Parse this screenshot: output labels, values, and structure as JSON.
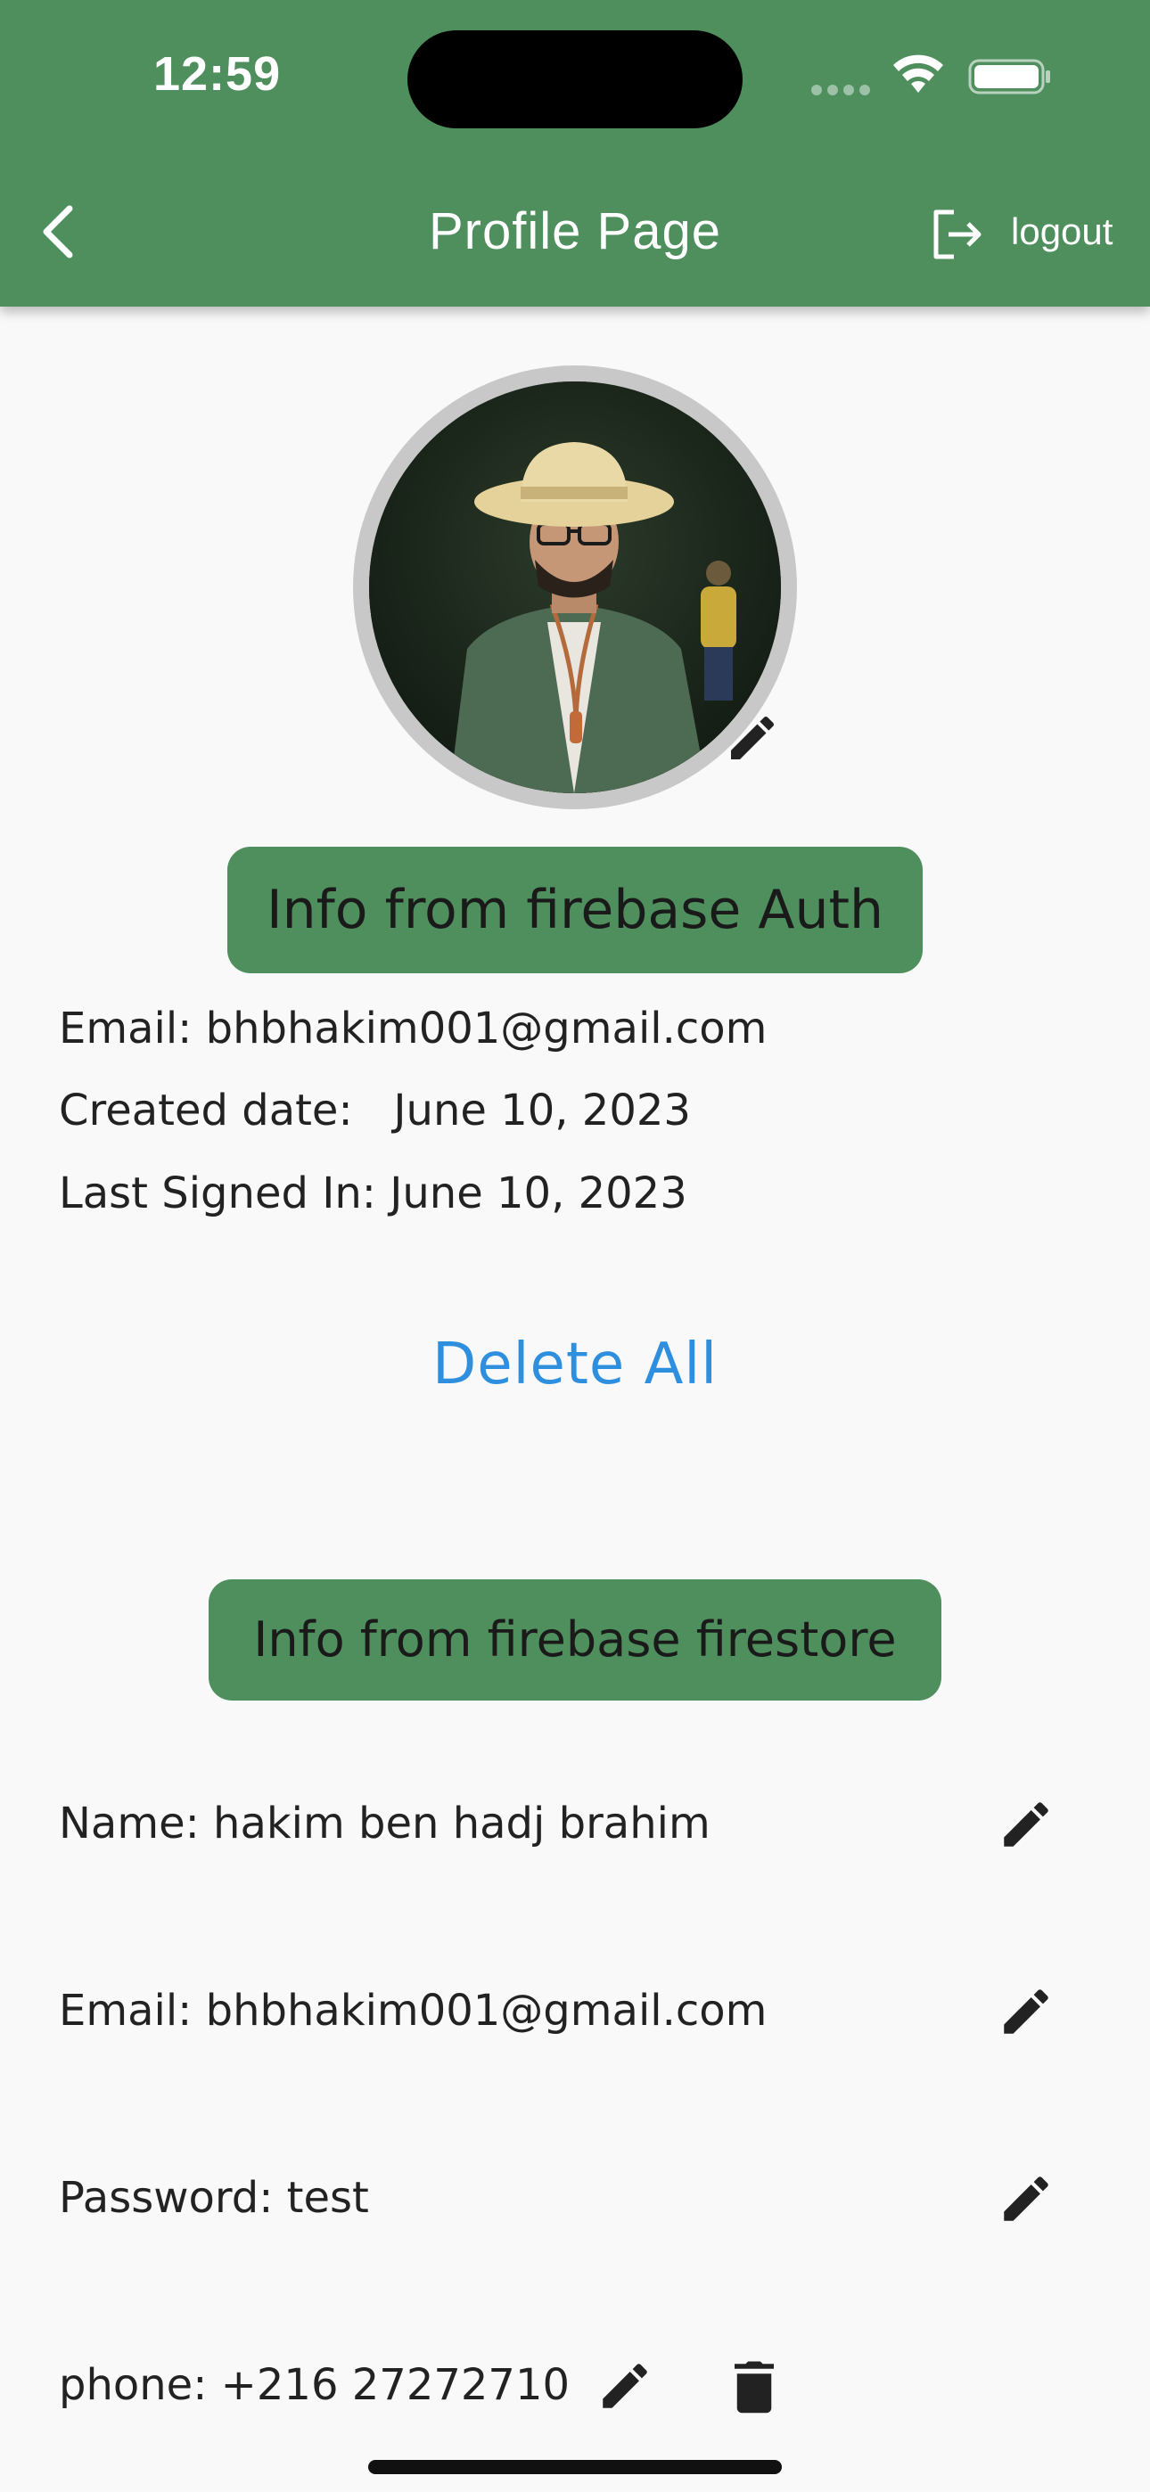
{
  "status_bar": {
    "time": "12:59"
  },
  "app_bar": {
    "title": "Profile Page",
    "logout_label": "logout"
  },
  "auth_section": {
    "badge": "Info from firebase Auth",
    "email": "Email: bhbhakim001@gmail.com",
    "created": "Created date:   June 10, 2023",
    "last_signed_in": "Last Signed In: June 10, 2023"
  },
  "delete_all_label": "Delete All",
  "firestore_section": {
    "badge": "Info from firebase firestore",
    "rows": [
      {
        "label": "Name: hakim ben hadj brahim"
      },
      {
        "label": "Email: bhbhakim001@gmail.com"
      },
      {
        "label": "Password: test"
      },
      {
        "label": "phone: +216 27272710"
      }
    ]
  },
  "colors": {
    "primary": "#4e8f5d",
    "link": "#2f8fdf",
    "background": "#f9f9f9"
  },
  "icons": [
    "back-icon",
    "logout-icon",
    "pencil-icon",
    "trash-icon",
    "wifi-icon",
    "battery-icon"
  ]
}
